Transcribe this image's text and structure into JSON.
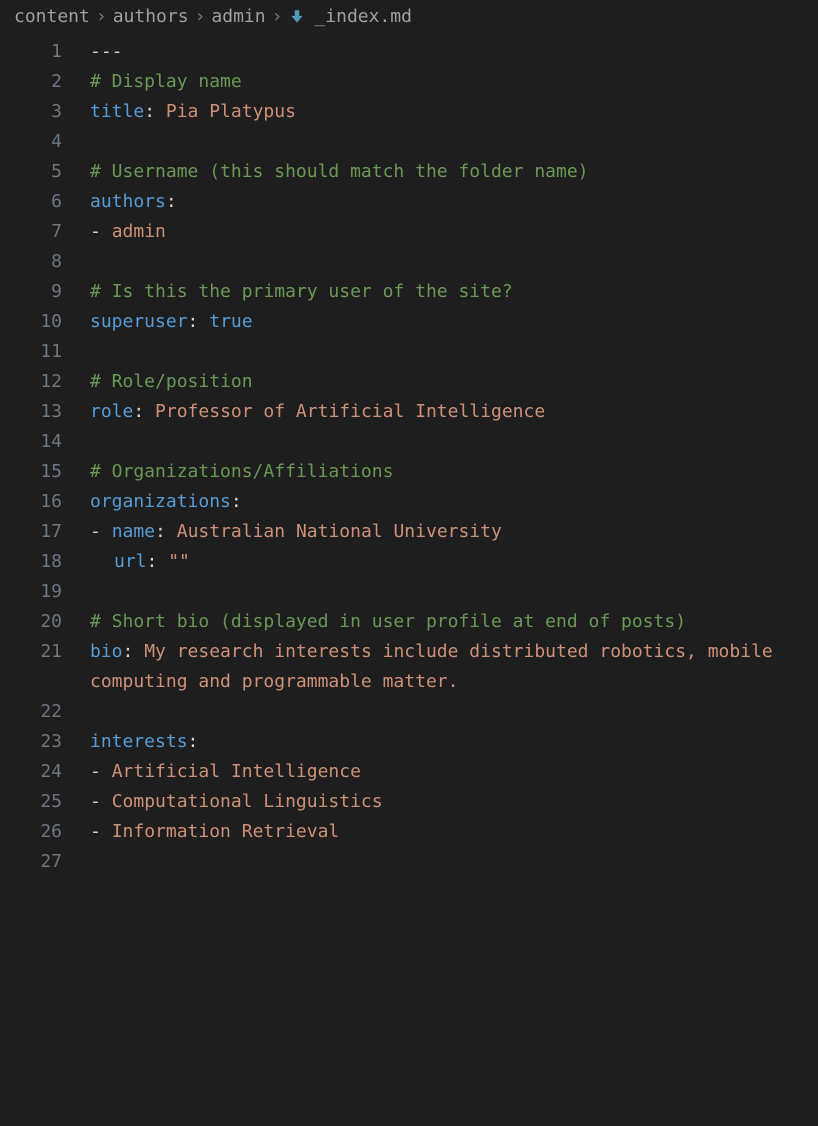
{
  "breadcrumb": {
    "items": [
      "content",
      "authors",
      "admin",
      "_index.md"
    ],
    "separator": "›"
  },
  "lines": [
    {
      "num": "1",
      "segments": [
        {
          "cls": "tk-punct",
          "text": "---"
        }
      ]
    },
    {
      "num": "2",
      "segments": [
        {
          "cls": "tk-comment",
          "text": "# Display name"
        }
      ]
    },
    {
      "num": "3",
      "segments": [
        {
          "cls": "tk-key",
          "text": "title"
        },
        {
          "cls": "tk-colon",
          "text": ": "
        },
        {
          "cls": "tk-value",
          "text": "Pia Platypus"
        }
      ]
    },
    {
      "num": "4",
      "segments": []
    },
    {
      "num": "5",
      "segments": [
        {
          "cls": "tk-comment",
          "text": "# Username (this should match the folder name)"
        }
      ]
    },
    {
      "num": "6",
      "segments": [
        {
          "cls": "tk-key",
          "text": "authors"
        },
        {
          "cls": "tk-colon",
          "text": ":"
        }
      ]
    },
    {
      "num": "7",
      "segments": [
        {
          "cls": "tk-dash",
          "text": "- "
        },
        {
          "cls": "tk-value",
          "text": "admin"
        }
      ]
    },
    {
      "num": "8",
      "segments": []
    },
    {
      "num": "9",
      "segments": [
        {
          "cls": "tk-comment",
          "text": "# Is this the primary user of the site?"
        }
      ]
    },
    {
      "num": "10",
      "segments": [
        {
          "cls": "tk-key",
          "text": "superuser"
        },
        {
          "cls": "tk-colon",
          "text": ": "
        },
        {
          "cls": "tk-bool",
          "text": "true"
        }
      ]
    },
    {
      "num": "11",
      "segments": []
    },
    {
      "num": "12",
      "segments": [
        {
          "cls": "tk-comment",
          "text": "# Role/position"
        }
      ]
    },
    {
      "num": "13",
      "segments": [
        {
          "cls": "tk-key",
          "text": "role"
        },
        {
          "cls": "tk-colon",
          "text": ": "
        },
        {
          "cls": "tk-value",
          "text": "Professor of Artificial Intelligence"
        }
      ]
    },
    {
      "num": "14",
      "segments": []
    },
    {
      "num": "15",
      "segments": [
        {
          "cls": "tk-comment",
          "text": "# Organizations/Affiliations"
        }
      ]
    },
    {
      "num": "16",
      "segments": [
        {
          "cls": "tk-key",
          "text": "organizations"
        },
        {
          "cls": "tk-colon",
          "text": ":"
        }
      ]
    },
    {
      "num": "17",
      "segments": [
        {
          "cls": "tk-dash",
          "text": "- "
        },
        {
          "cls": "tk-key",
          "text": "name"
        },
        {
          "cls": "tk-colon",
          "text": ": "
        },
        {
          "cls": "tk-value",
          "text": "Australian National University"
        }
      ]
    },
    {
      "num": "18",
      "segments": [
        {
          "cls": "tk-punct",
          "text": "  "
        },
        {
          "cls": "tk-key",
          "text": "url"
        },
        {
          "cls": "tk-colon",
          "text": ": "
        },
        {
          "cls": "tk-value",
          "text": "\"\""
        }
      ],
      "guide": true
    },
    {
      "num": "19",
      "segments": []
    },
    {
      "num": "20",
      "segments": [
        {
          "cls": "tk-comment",
          "text": "# Short bio (displayed in user profile at end of posts)"
        }
      ]
    },
    {
      "num": "21",
      "segments": [
        {
          "cls": "tk-key",
          "text": "bio"
        },
        {
          "cls": "tk-colon",
          "text": ": "
        },
        {
          "cls": "tk-value",
          "text": "My research interests include distributed robotics, mobile computing and programmable matter."
        }
      ]
    },
    {
      "num": "22",
      "segments": []
    },
    {
      "num": "23",
      "segments": [
        {
          "cls": "tk-key",
          "text": "interests"
        },
        {
          "cls": "tk-colon",
          "text": ":"
        }
      ]
    },
    {
      "num": "24",
      "segments": [
        {
          "cls": "tk-dash",
          "text": "- "
        },
        {
          "cls": "tk-value",
          "text": "Artificial Intelligence"
        }
      ]
    },
    {
      "num": "25",
      "segments": [
        {
          "cls": "tk-dash",
          "text": "- "
        },
        {
          "cls": "tk-value",
          "text": "Computational Linguistics"
        }
      ]
    },
    {
      "num": "26",
      "segments": [
        {
          "cls": "tk-dash",
          "text": "- "
        },
        {
          "cls": "tk-value",
          "text": "Information Retrieval"
        }
      ]
    },
    {
      "num": "27",
      "segments": []
    }
  ]
}
